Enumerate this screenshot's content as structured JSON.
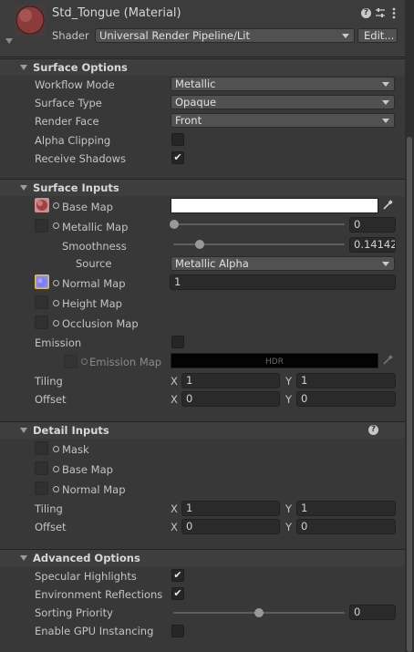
{
  "header": {
    "material_name": "Std_Tongue (Material)",
    "shader_label": "Shader",
    "shader_value": "Universal Render Pipeline/Lit",
    "edit_button": "Edit...",
    "icons": [
      "help-icon",
      "settings-sliders-icon",
      "more-menu-icon"
    ]
  },
  "surface_options": {
    "title": "Surface Options",
    "workflow_mode": {
      "label": "Workflow Mode",
      "value": "Metallic"
    },
    "surface_type": {
      "label": "Surface Type",
      "value": "Opaque"
    },
    "render_face": {
      "label": "Render Face",
      "value": "Front"
    },
    "alpha_clipping": {
      "label": "Alpha Clipping",
      "checked": false
    },
    "receive_shadows": {
      "label": "Receive Shadows",
      "checked": true,
      "mark": "✔"
    }
  },
  "surface_inputs": {
    "title": "Surface Inputs",
    "base_map": {
      "label": "Base Map",
      "color": "#ffffff"
    },
    "metallic_map": {
      "label": "Metallic Map",
      "value": "0",
      "level": 0
    },
    "smoothness": {
      "label": "Smoothness",
      "value": "0.14142",
      "level": 0.14142
    },
    "source": {
      "label": "Source",
      "value": "Metallic Alpha"
    },
    "normal_map": {
      "label": "Normal Map",
      "value": "1"
    },
    "height_map": {
      "label": "Height Map"
    },
    "occlusion_map": {
      "label": "Occlusion Map"
    },
    "emission": {
      "label": "Emission",
      "checked": false
    },
    "emission_map": {
      "label": "Emission Map",
      "hdr": "HDR"
    },
    "tiling": {
      "label": "Tiling",
      "x_label": "X",
      "x": "1",
      "y_label": "Y",
      "y": "1"
    },
    "offset": {
      "label": "Offset",
      "x_label": "X",
      "x": "0",
      "y_label": "Y",
      "y": "0"
    }
  },
  "detail_inputs": {
    "title": "Detail Inputs",
    "mask": {
      "label": "Mask"
    },
    "base_map": {
      "label": "Base Map"
    },
    "normal_map": {
      "label": "Normal Map"
    },
    "tiling": {
      "label": "Tiling",
      "x_label": "X",
      "x": "1",
      "y_label": "Y",
      "y": "1"
    },
    "offset": {
      "label": "Offset",
      "x_label": "X",
      "x": "0",
      "y_label": "Y",
      "y": "0"
    }
  },
  "advanced_options": {
    "title": "Advanced Options",
    "specular_highlights": {
      "label": "Specular Highlights",
      "checked": true,
      "mark": "✔"
    },
    "environment_reflections": {
      "label": "Environment Reflections",
      "checked": true,
      "mark": "✔"
    },
    "sorting_priority": {
      "label": "Sorting Priority",
      "value": "0",
      "level": 0.5
    },
    "gpu_instancing": {
      "label": "Enable GPU Instancing",
      "checked": false
    }
  },
  "colors": {
    "background": "#383838",
    "section_header": "#3e3e3e",
    "field": "#2a2a2a",
    "dropdown": "#515151",
    "text": "#c4c4c4"
  }
}
